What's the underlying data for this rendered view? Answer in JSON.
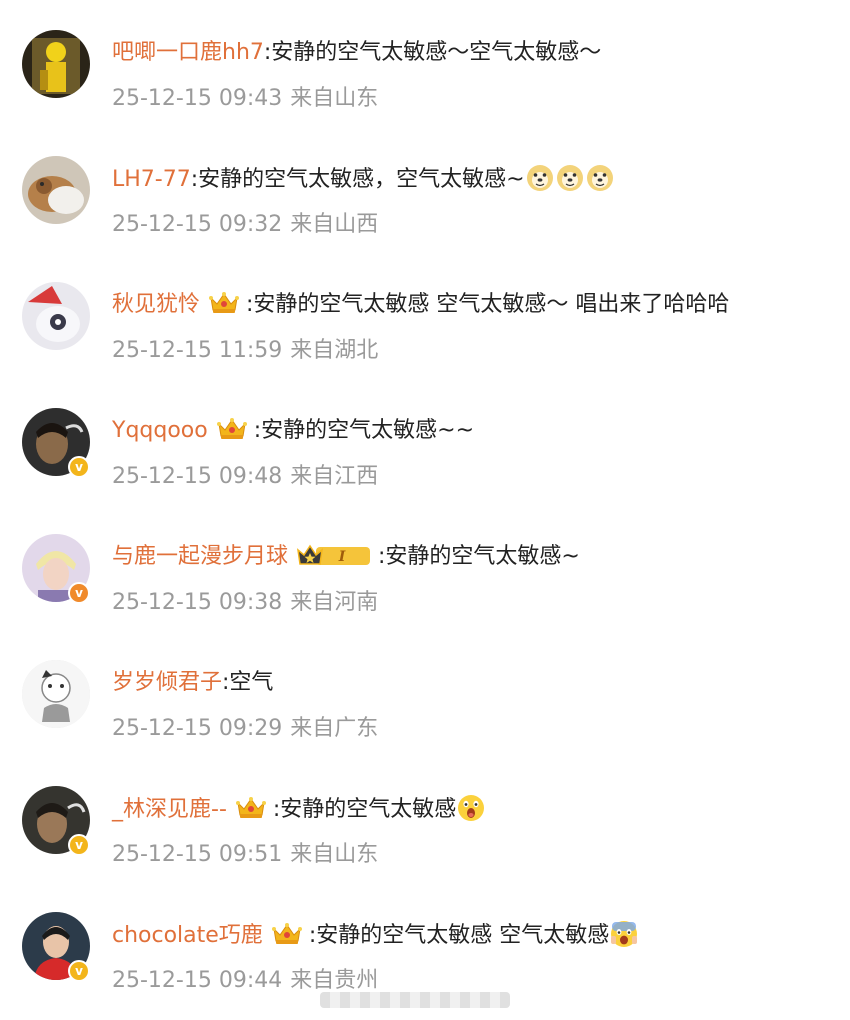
{
  "comments": [
    {
      "username": "吧唧一口鹿hh7",
      "content": ":安静的空气太敏感～空气太敏感～",
      "time": "25-12-15 09:43",
      "location": "来自山东",
      "avatar_color": "#c9a41b",
      "badge": "",
      "trailing_emoji": []
    },
    {
      "username": "LH7-77",
      "content": ":安静的空气太敏感，空气太敏感~",
      "time": "25-12-15 09:32",
      "location": "来自山西",
      "avatar_color": "#b58a5e",
      "badge": "",
      "trailing_emoji": [
        "doge-emoji",
        "doge-emoji",
        "doge-emoji"
      ]
    },
    {
      "username": "秋见犹怜",
      "content": ":安静的空气太敏感 空气太敏感～ 唱出来了哈哈哈",
      "time": "25-12-15 11:59",
      "location": "来自湖北",
      "avatar_color": "#e6e6ea",
      "badge": "crown-icon",
      "trailing_emoji": []
    },
    {
      "username": "Yqqqooo",
      "content": ":安静的空气太敏感~~",
      "time": "25-12-15 09:48",
      "location": "来自江西",
      "avatar_color": "#3a3a3a",
      "badge": "crown-icon",
      "trailing_emoji": []
    },
    {
      "username": "与鹿一起漫步月球",
      "content": ":安静的空气太敏感~",
      "time": "25-12-15 09:38",
      "location": "来自河南",
      "avatar_color": "#d9c9dd",
      "badge": "crown-level-badge",
      "badge_text": "I",
      "trailing_emoji": []
    },
    {
      "username": "岁岁倾君子",
      "content": ":空气",
      "time": "25-12-15 09:29",
      "location": "来自广东",
      "avatar_color": "#f4f4f4",
      "badge": "",
      "trailing_emoji": []
    },
    {
      "username": "_林深见鹿--",
      "content": ":安静的空气太敏感",
      "time": "25-12-15 09:51",
      "location": "来自山东",
      "avatar_color": "#3b3a36",
      "badge": "crown-icon",
      "trailing_emoji": [
        "surprised-emoji"
      ]
    },
    {
      "username": "chocolate巧鹿",
      "content": ":安静的空气太敏感 空气太敏感",
      "time": "25-12-15 09:44",
      "location": "来自贵州",
      "avatar_color": "#4a2a22",
      "badge": "crown-icon",
      "trailing_emoji": [
        "shocked-emoji"
      ]
    }
  ],
  "colors": {
    "username": "#e0703a",
    "meta": "#9a9a9a",
    "text": "#222222",
    "badge_gold": "#f3b51b"
  }
}
